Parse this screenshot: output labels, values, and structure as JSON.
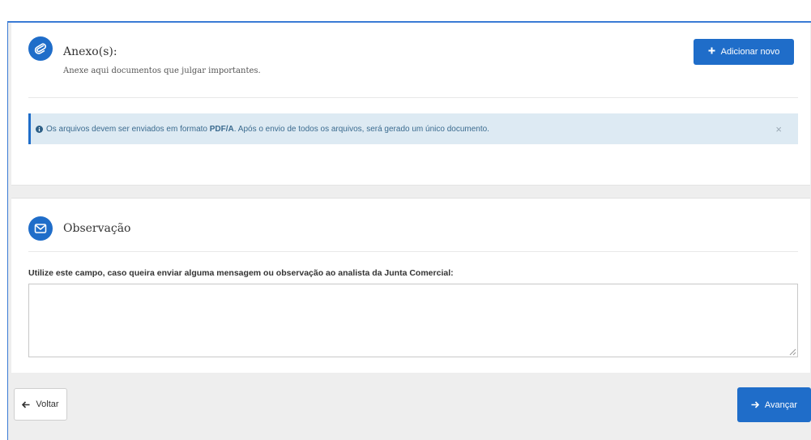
{
  "anexos": {
    "icon": "paperclip-icon",
    "title": "Anexo(s):",
    "subtitle": "Anexe aqui documentos que julgar importantes.",
    "add_button": {
      "icon": "plus-icon",
      "label": "Adicionar novo"
    },
    "alert": {
      "icon": "info-circle-icon",
      "text_before": "Os arquivos devem ser enviados em formato ",
      "format": "PDF/A",
      "text_after": ". Após o envio de todos os arquivos, será gerado um único documento.",
      "close": "×"
    }
  },
  "observacao": {
    "icon": "envelope-icon",
    "title": "Observação",
    "field_label": "Utilize este campo, caso queira enviar alguma mensagem ou observação ao analista da Junta Comercial:",
    "field_value": ""
  },
  "footer": {
    "back_button": {
      "icon": "arrow-left-icon",
      "label": "Voltar"
    },
    "next_button": {
      "icon": "arrow-right-icon",
      "label": "Avançar"
    }
  },
  "colors": {
    "primary": "#1f6dc9",
    "alert_background": "#ddeaf3",
    "frame_border": "#3a7bd5"
  }
}
